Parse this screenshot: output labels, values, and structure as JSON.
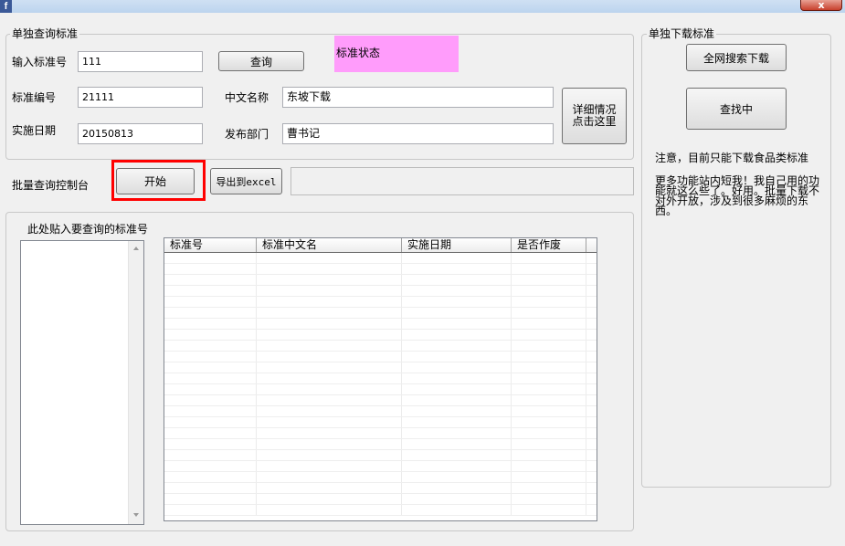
{
  "window": {
    "app_icon": "f",
    "close_icon": "x"
  },
  "single_query": {
    "legend": "单独查询标准",
    "input_label": "输入标准号",
    "input_value": "111",
    "query_button": "查询",
    "status_label": "标准状态",
    "number_label": "标准编号",
    "number_value": "21111",
    "date_label": "实施日期",
    "date_value": "20150813",
    "cn_name_label": "中文名称",
    "cn_name_value": "东坡下载",
    "dept_label": "发布部门",
    "dept_value": "曹书记",
    "detail_button": "详细情况\n点击这里"
  },
  "batch": {
    "console_label": "批量查询控制台",
    "start_button": "开始",
    "export_button": "导出到excel",
    "paste_label": "此处贴入要查询的标准号",
    "columns": [
      "标准号",
      "标准中文名",
      "实施日期",
      "是否作废"
    ]
  },
  "download": {
    "legend": "单独下载标准",
    "search_button": "全网搜索下载",
    "searching_button": "查找中",
    "note1": "注意，目前只能下载食品类标准",
    "note2": "更多功能站内短我！我自己用的功能就这么些了。好用。批量下载不对外开放，涉及到很多麻烦的东西。"
  },
  "colors": {
    "status_bg": "#ff9cfb",
    "highlight": "#ff0000"
  }
}
